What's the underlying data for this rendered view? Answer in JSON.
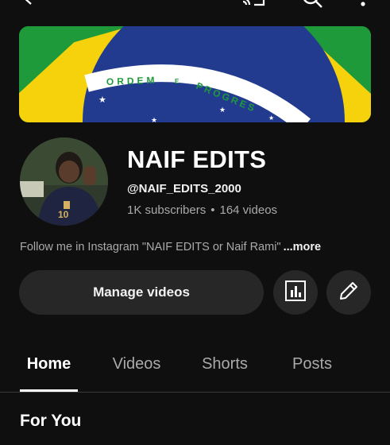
{
  "header": {
    "back_icon": "back-arrow-icon",
    "icons": [
      "cast-icon",
      "search-icon",
      "more-vert-icon"
    ]
  },
  "banner": {
    "motto": "ORDEM E PROGRES",
    "colors": {
      "green": "#1f9a3b",
      "yellow": "#f5d20b",
      "blue": "#223b8f",
      "white": "#ffffff"
    }
  },
  "channel": {
    "name": "NAIF EDITS",
    "handle": "@NAIF_EDITS_2000",
    "subscribers": "1K subscribers",
    "separator": "•",
    "videos": "164 videos",
    "description": "Follow me in Instagram \"NAIF EDITS or Naif Rami\"",
    "more_label": "...more"
  },
  "actions": {
    "manage_videos_label": "Manage videos",
    "analytics_icon": "analytics-icon",
    "edit_icon": "pencil-icon"
  },
  "tabs": [
    {
      "label": "Home",
      "active": true
    },
    {
      "label": "Videos",
      "active": false
    },
    {
      "label": "Shorts",
      "active": false
    },
    {
      "label": "Posts",
      "active": false
    }
  ],
  "section": {
    "title": "For You"
  }
}
